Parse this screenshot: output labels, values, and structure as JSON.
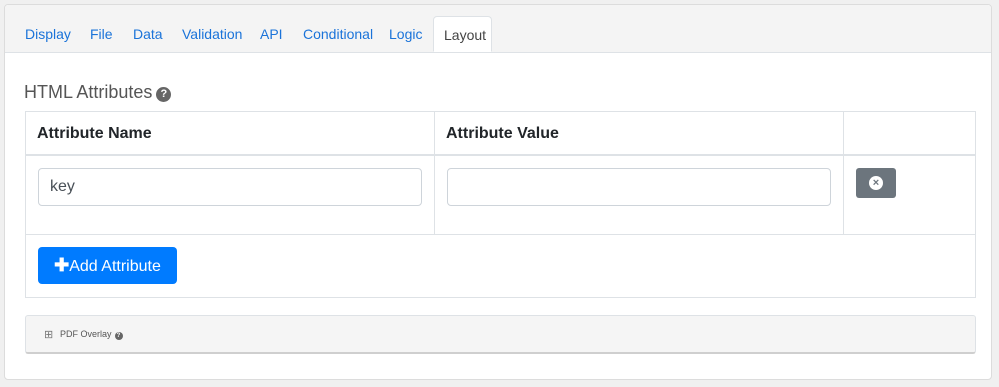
{
  "tabs": [
    {
      "label": "Display"
    },
    {
      "label": "File"
    },
    {
      "label": "Data"
    },
    {
      "label": "Validation"
    },
    {
      "label": "API"
    },
    {
      "label": "Conditional"
    },
    {
      "label": "Logic"
    },
    {
      "label": "Layout",
      "active": true
    }
  ],
  "section": {
    "title": "HTML Attributes",
    "help_icon": "?"
  },
  "table": {
    "headers": {
      "name": "Attribute Name",
      "value": "Attribute Value"
    },
    "rows": [
      {
        "name": "key",
        "value": ""
      }
    ],
    "remove_icon": "×",
    "add_button": {
      "icon": "✚",
      "label": "Add Attribute"
    }
  },
  "panel": {
    "toggle_icon": "⊞",
    "title": "PDF Overlay",
    "help_icon": "?"
  },
  "colors": {
    "accent": "#007bff",
    "link": "#1a73d9",
    "secondary": "#6c757d"
  }
}
